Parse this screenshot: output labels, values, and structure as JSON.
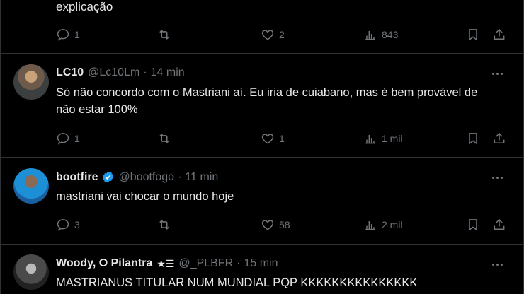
{
  "partial_post": {
    "text": "explicação",
    "actions": {
      "replies": "1",
      "reposts": "",
      "likes": "2",
      "views": "843"
    }
  },
  "posts": [
    {
      "display_name": "LC10",
      "handle": "@Lc10Lm",
      "separator": "·",
      "time": "14 min",
      "text": "Só não concordo com o Mastriani aí. Eu iria de cuiabano, mas é bem provável de não estar 100%",
      "actions": {
        "replies": "1",
        "reposts": "",
        "likes": "1",
        "views": "1 mil"
      }
    },
    {
      "display_name": "bootfire",
      "handle": "@bootfogo",
      "separator": "·",
      "time": "11 min",
      "text": "mastriani vai chocar o mundo hoje",
      "actions": {
        "replies": "3",
        "reposts": "",
        "likes": "58",
        "views": "2 mil"
      }
    },
    {
      "display_name": "Woody, O Pilantra",
      "flag": "★☰",
      "handle": "@_PLBFR",
      "separator": "·",
      "time": "15 min",
      "text": "MASTRIANUS TITULAR NUM MUNDIAL PQP KKKKKKKKKKKKKKK"
    }
  ],
  "icons": [
    "reply-icon",
    "repost-icon",
    "like-icon",
    "views-icon",
    "bookmark-icon",
    "share-icon",
    "more-icon",
    "verified-badge-icon"
  ],
  "colors": {
    "background": "#000000",
    "text": "#e7e9ea",
    "secondary": "#71767b",
    "verified": "#1d9bf0",
    "divider": "#2f3336"
  }
}
